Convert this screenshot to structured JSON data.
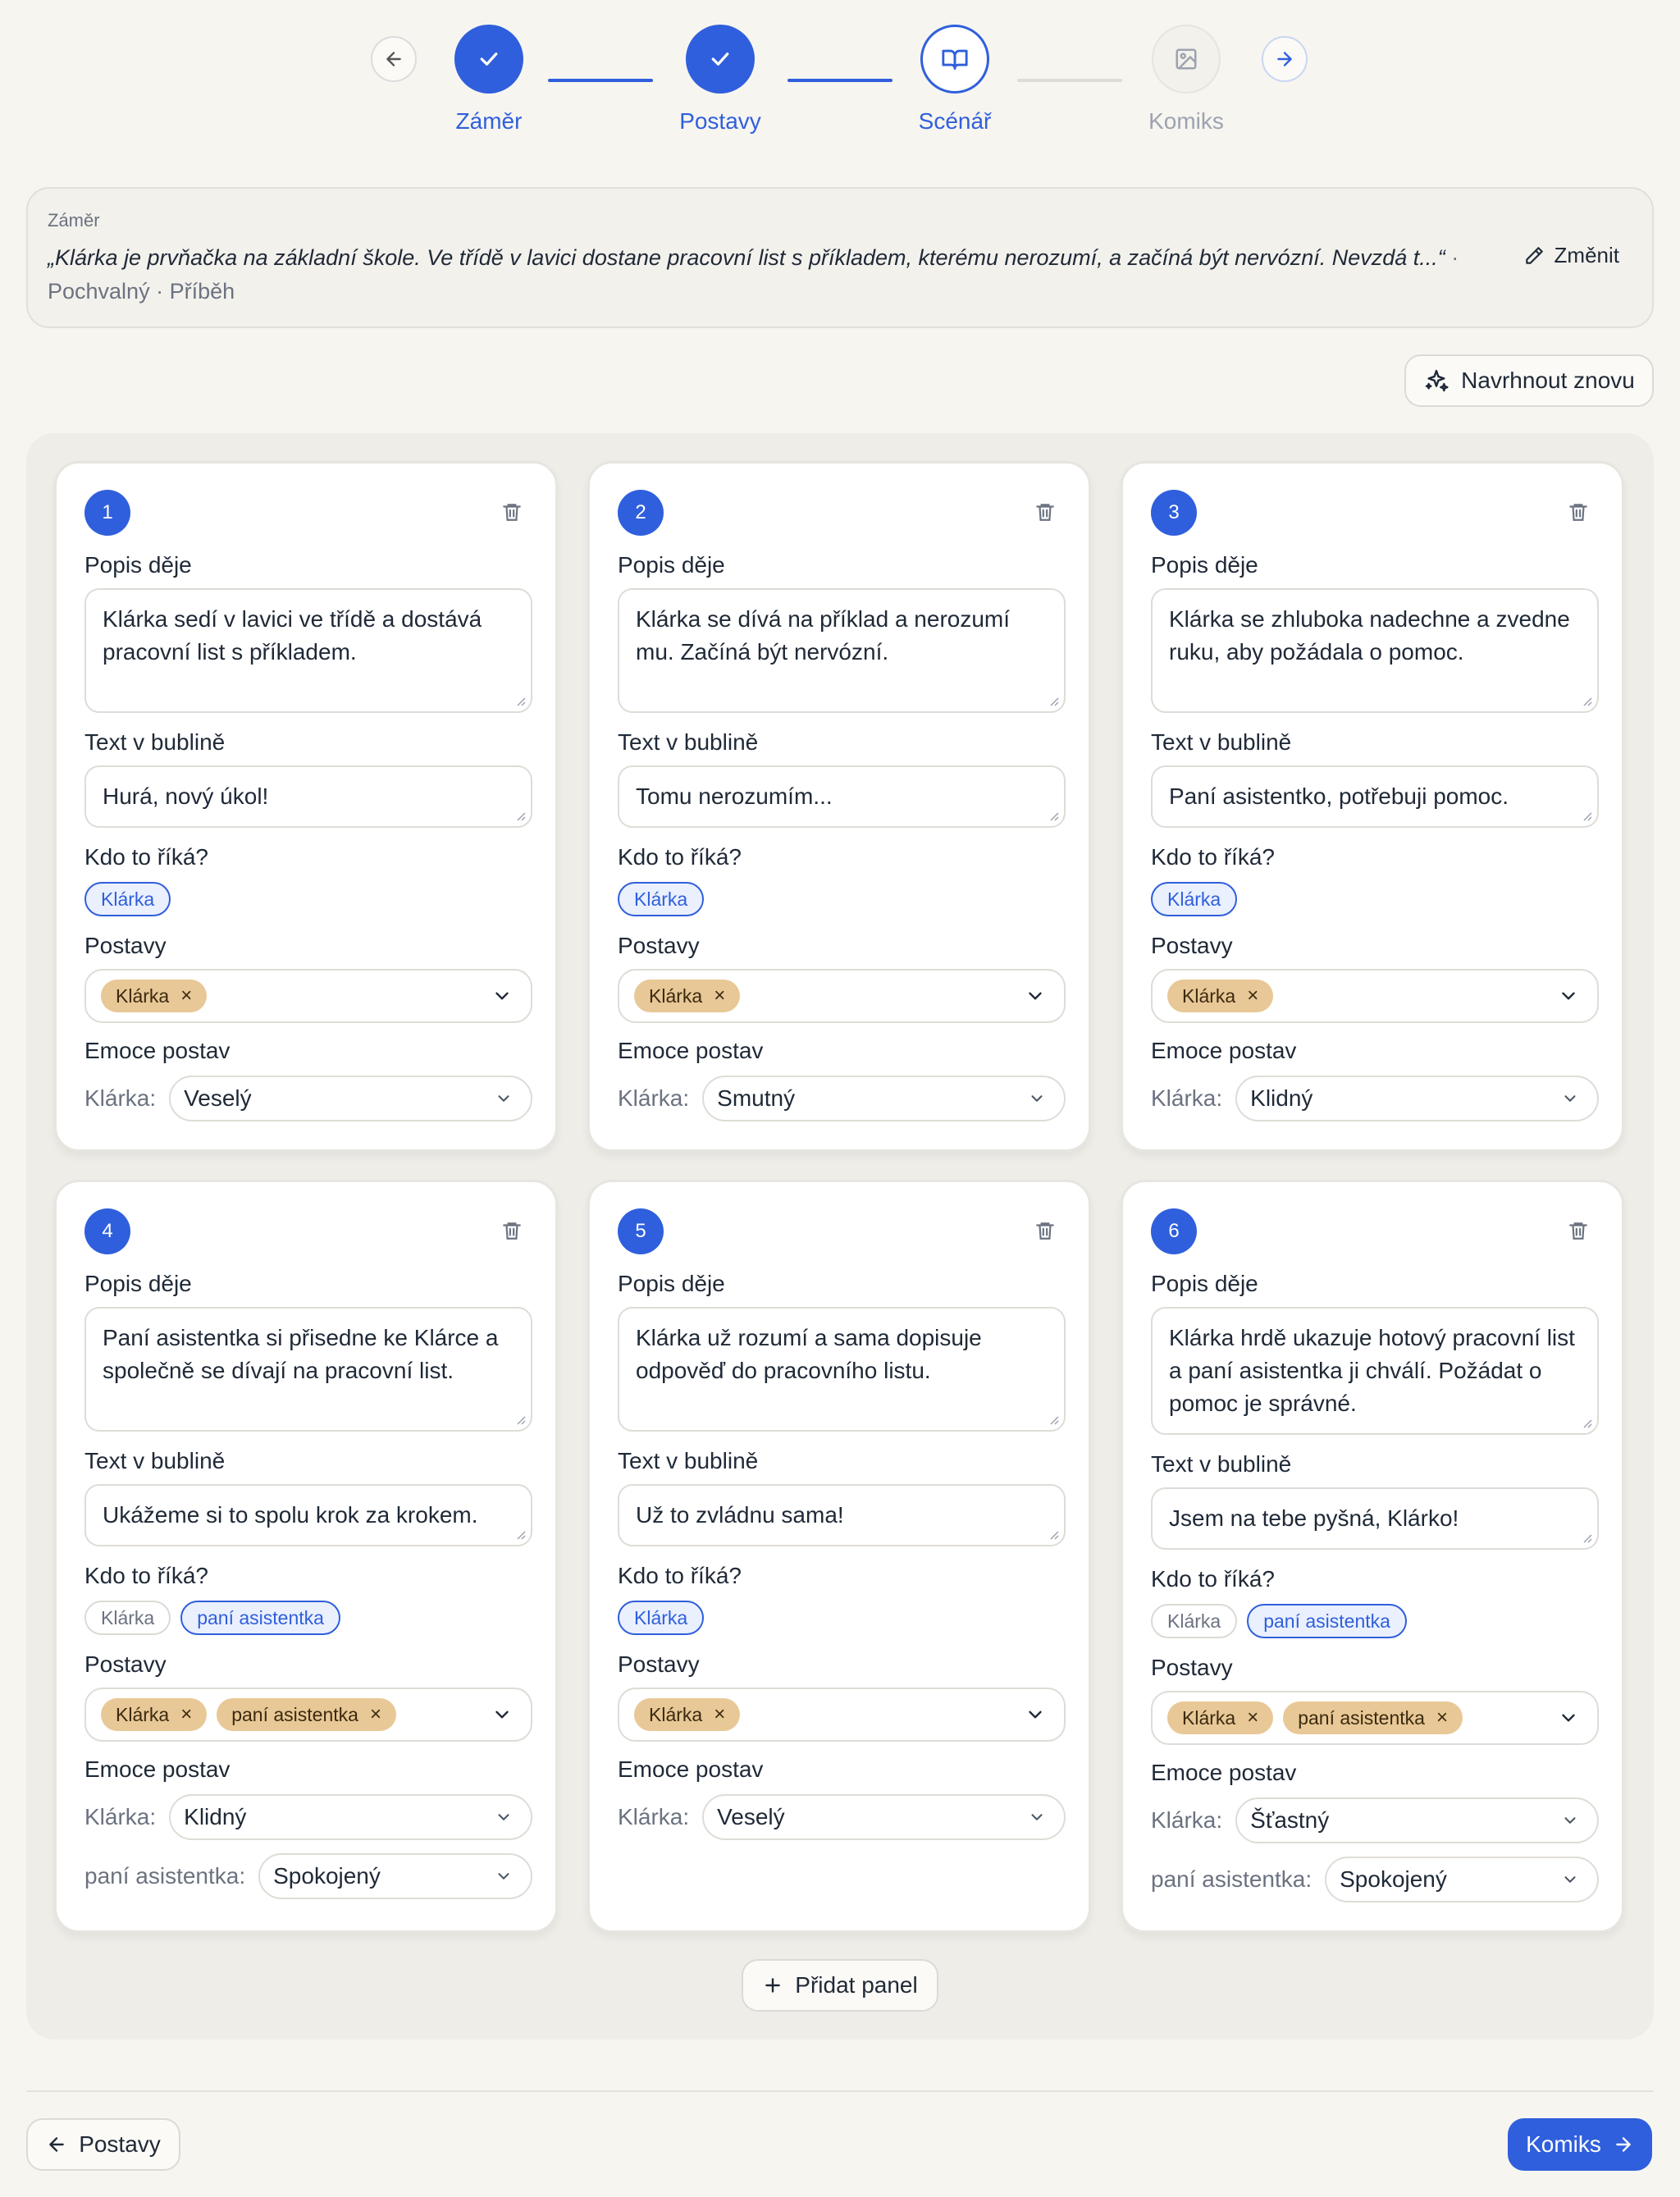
{
  "stepper": {
    "steps": [
      {
        "label": "Záměr",
        "state": "done"
      },
      {
        "label": "Postavy",
        "state": "done"
      },
      {
        "label": "Scénář",
        "state": "active"
      },
      {
        "label": "Komiks",
        "state": "pending"
      }
    ]
  },
  "intent": {
    "caption": "Záměr",
    "quote": "„Klárka je prvňačka na základní škole. Ve třídě v lavici dostane pracovní list s příkladem, kterému nerozumí, a začíná být nervózní. Nevzdá t...“",
    "meta": " · Pochvalný · Příběh",
    "change_label": "Změnit"
  },
  "regenerate_label": "Navrhnout znovu",
  "labels": {
    "description": "Popis děje",
    "bubble": "Text v bublině",
    "speaker": "Kdo to říká?",
    "characters": "Postavy",
    "emotions": "Emoce postav"
  },
  "panels": [
    {
      "number": "1",
      "description": "Klárka sedí v lavici ve třídě a dostává pracovní list s příkladem.",
      "bubble": "Hurá, nový úkol!",
      "speakers": [
        {
          "name": "Klárka",
          "selected": true
        }
      ],
      "characters": [
        "Klárka"
      ],
      "emotions": [
        {
          "who": "Klárka:",
          "value": "Veselý"
        }
      ]
    },
    {
      "number": "2",
      "description": "Klárka se dívá na příklad a nerozumí mu. Začíná být nervózní.",
      "bubble": "Tomu nerozumím...",
      "speakers": [
        {
          "name": "Klárka",
          "selected": true
        }
      ],
      "characters": [
        "Klárka"
      ],
      "emotions": [
        {
          "who": "Klárka:",
          "value": "Smutný"
        }
      ]
    },
    {
      "number": "3",
      "description": "Klárka se zhluboka nadechne a zvedne ruku, aby požádala o pomoc.",
      "bubble": "Paní asistentko, potřebuji pomoc.",
      "speakers": [
        {
          "name": "Klárka",
          "selected": true
        }
      ],
      "characters": [
        "Klárka"
      ],
      "emotions": [
        {
          "who": "Klárka:",
          "value": "Klidný"
        }
      ]
    },
    {
      "number": "4",
      "description": "Paní asistentka si přisedne ke Klárce a společně se dívají na pracovní list.",
      "bubble": "Ukážeme si to spolu krok za krokem.",
      "speakers": [
        {
          "name": "Klárka",
          "selected": false
        },
        {
          "name": "paní asistentka",
          "selected": true
        }
      ],
      "characters": [
        "Klárka",
        "paní asistentka"
      ],
      "emotions": [
        {
          "who": "Klárka:",
          "value": "Klidný"
        },
        {
          "who": "paní asistentka:",
          "value": "Spokojený"
        }
      ]
    },
    {
      "number": "5",
      "description": "Klárka už rozumí a sama dopisuje odpověď do pracovního listu.",
      "bubble": "Už to zvládnu sama!",
      "speakers": [
        {
          "name": "Klárka",
          "selected": true
        }
      ],
      "characters": [
        "Klárka"
      ],
      "emotions": [
        {
          "who": "Klárka:",
          "value": "Veselý"
        }
      ]
    },
    {
      "number": "6",
      "description": "Klárka hrdě ukazuje hotový pracovní list a paní asistentka ji chválí. Požádat o pomoc je správné.",
      "bubble": "Jsem na tebe pyšná, Klárko!",
      "speakers": [
        {
          "name": "Klárka",
          "selected": false
        },
        {
          "name": "paní asistentka",
          "selected": true
        }
      ],
      "characters": [
        "Klárka",
        "paní asistentka"
      ],
      "emotions": [
        {
          "who": "Klárka:",
          "value": "Šťastný"
        },
        {
          "who": "paní asistentka:",
          "value": "Spokojený"
        }
      ]
    }
  ],
  "add_panel_label": "Přidat panel",
  "footer": {
    "back_label": "Postavy",
    "next_label": "Komiks"
  },
  "colors": {
    "accent": "#2f5fdc",
    "tag": "#e8c896",
    "background": "#f7f5f0"
  }
}
